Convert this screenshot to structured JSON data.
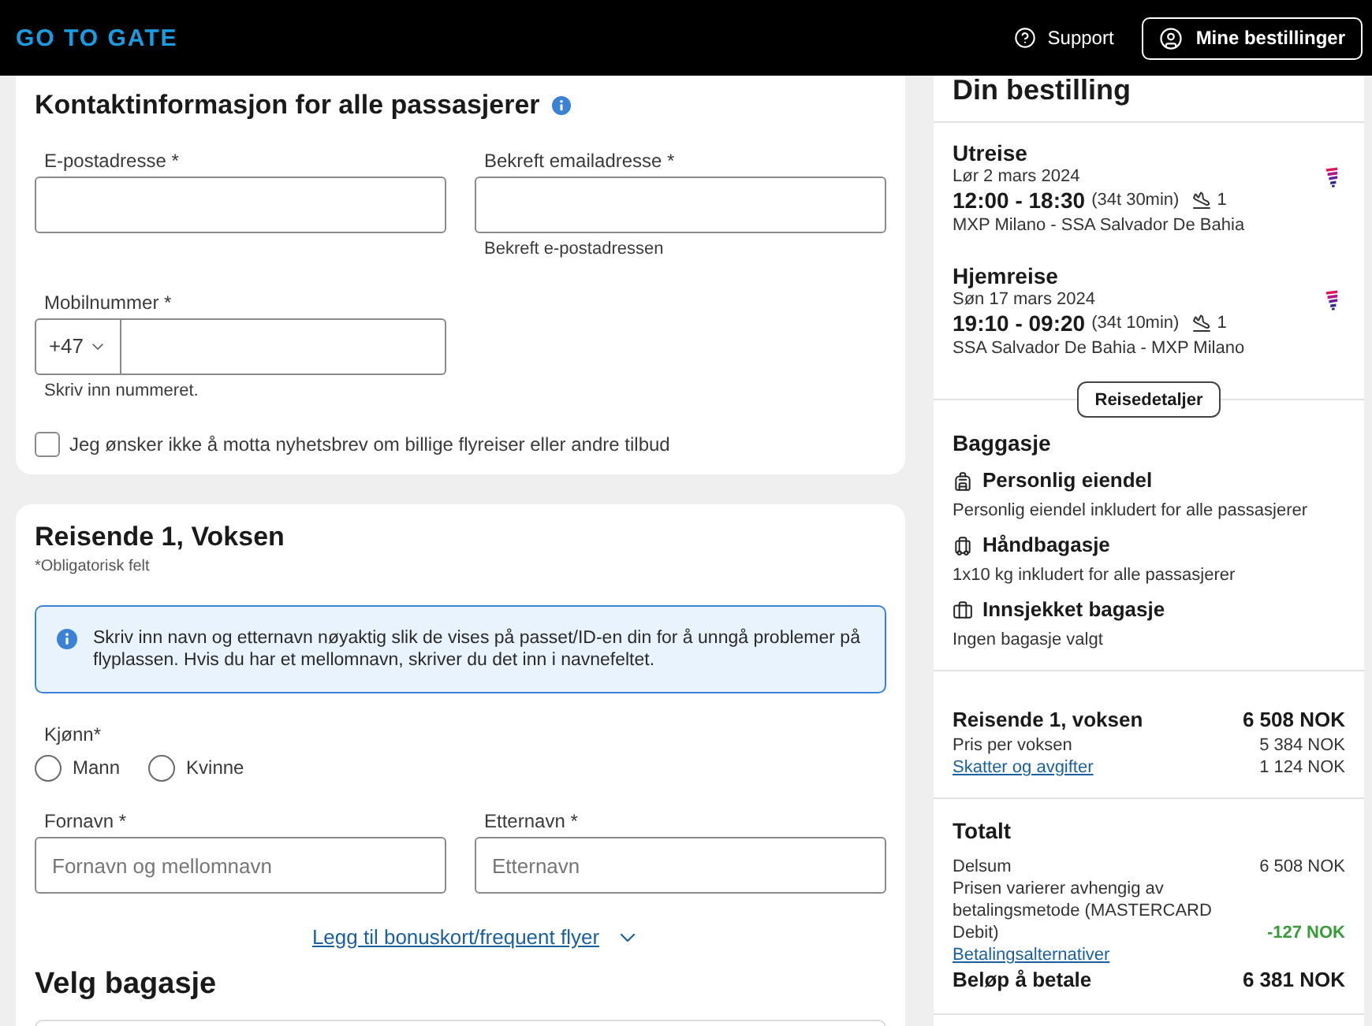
{
  "header": {
    "logo": "GO TO GATE",
    "support": "Support",
    "account_button": "Mine bestillinger"
  },
  "contact_card": {
    "title": "Kontaktinformasjon for alle passasjerer",
    "fields": [
      {
        "label": "E-postadresse *"
      },
      {
        "label": "Bekreft emailadresse *",
        "hint": "Bekreft e-postadressen"
      }
    ],
    "phone": {
      "label": "Mobilnummer *",
      "country_code": "+47",
      "hint": "Skriv inn nummeret."
    },
    "newsletter_optout": {
      "label": "Jeg ønsker ikke å motta nyhetsbrev om billige flyreiser eller andre tilbud",
      "checked": false
    }
  },
  "traveller_card": {
    "title": "Reisende 1, Voksen",
    "required_note": "*Obligatorisk felt",
    "info": "Skriv inn navn og etternavn nøyaktig slik de vises på passet/ID-en din for å unngå problemer på flyplassen. Hvis du har et mellomnavn, skriver du det inn i navnefeltet.",
    "gender": {
      "label": "Kjønn*",
      "options": [
        {
          "label": "Mann",
          "selected": false
        },
        {
          "label": "Kvinne",
          "selected": false
        }
      ]
    },
    "name_fields": [
      {
        "label": "Fornavn *",
        "placeholder": "Fornavn og mellomnavn"
      },
      {
        "label": "Etternavn *",
        "placeholder": "Etternavn"
      }
    ],
    "bonus_link": "Legg til bonuskort/frequent flyer",
    "baggage_title": "Velg bagasje"
  },
  "summary": {
    "title": "Din bestilling",
    "legs": [
      {
        "title": "Utreise",
        "date": "Lør 2 mars 2024",
        "times": "12:00 - 18:30",
        "duration": "(34t 30min)",
        "stops": "1",
        "route": "MXP Milano - SSA Salvador De Bahia"
      },
      {
        "title": "Hjemreise",
        "date": "Søn 17 mars 2024",
        "times": "19:10 - 09:20",
        "duration": "(34t 10min)",
        "stops": "1",
        "route": "SSA Salvador De Bahia - MXP Milano"
      }
    ],
    "details_button": "Reisedetaljer",
    "baggage": {
      "title": "Baggasje",
      "items": [
        {
          "kind": "personal",
          "name": "Personlig eiendel",
          "description": "Personlig eiendel inkludert for alle passasjerer"
        },
        {
          "kind": "cabin",
          "name": "Håndbagasje",
          "description": "1x10 kg inkludert for alle passasjerer"
        },
        {
          "kind": "checked",
          "name": "Innsjekket bagasje",
          "description": "Ingen bagasje valgt"
        }
      ]
    },
    "traveller_price": {
      "title": "Reisende 1, voksen",
      "total": "6 508 NOK",
      "lines": [
        {
          "kind": "text",
          "label": "Pris per voksen",
          "amount": "5 384 NOK"
        },
        {
          "kind": "link",
          "label": "Skatter og avgifter",
          "amount": "1 124 NOK"
        }
      ]
    },
    "totals": {
      "title": "Totalt",
      "subtotal_label": "Delsum",
      "subtotal": "6 508 NOK",
      "fee_note": "Prisen varierer avhengig av betalingsmetode (MASTERCARD Debit)",
      "fee": "-127 NOK",
      "payment_link": "Betalingsalternativer",
      "due_label": "Beløp å betale",
      "due": "6 381 NOK"
    }
  }
}
